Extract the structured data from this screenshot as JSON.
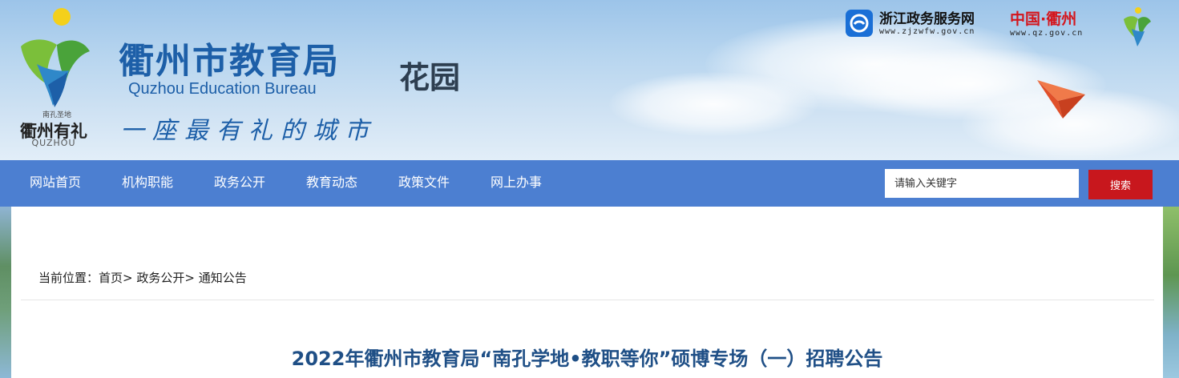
{
  "header": {
    "bureau_name_cn": "衢州市教育局",
    "bureau_name_en": "Quzhou Education Bureau",
    "slogan": "一座最有礼的城市",
    "section_name": "花园",
    "logo": {
      "small_text": "南孔圣地",
      "city_name": "衢州有礼",
      "pinyin": "QUZHOU"
    },
    "links": {
      "zj_title": "浙江政务服务网",
      "zj_url": "www.zjzwfw.gov.cn",
      "qz_title": "中国·衢州",
      "qz_url": "www.qz.gov.cn"
    }
  },
  "nav": {
    "items": [
      "网站首页",
      "机构职能",
      "政务公开",
      "教育动态",
      "政策文件",
      "网上办事"
    ]
  },
  "search": {
    "placeholder": "请输入关键字",
    "button_label": "搜索"
  },
  "breadcrumb": {
    "prefix": "当前位置：",
    "items": [
      "首页",
      "政务公开",
      "通知公告"
    ],
    "separator": "> "
  },
  "article": {
    "title": "2022年衢州市教育局“南孔学地•教职等你”硕博专场（一）招聘公告"
  },
  "colors": {
    "nav_bg": "#4c7fd1",
    "search_button": "#c8171d",
    "brand_blue": "#1d5fa8",
    "title_blue": "#1f4f86"
  }
}
